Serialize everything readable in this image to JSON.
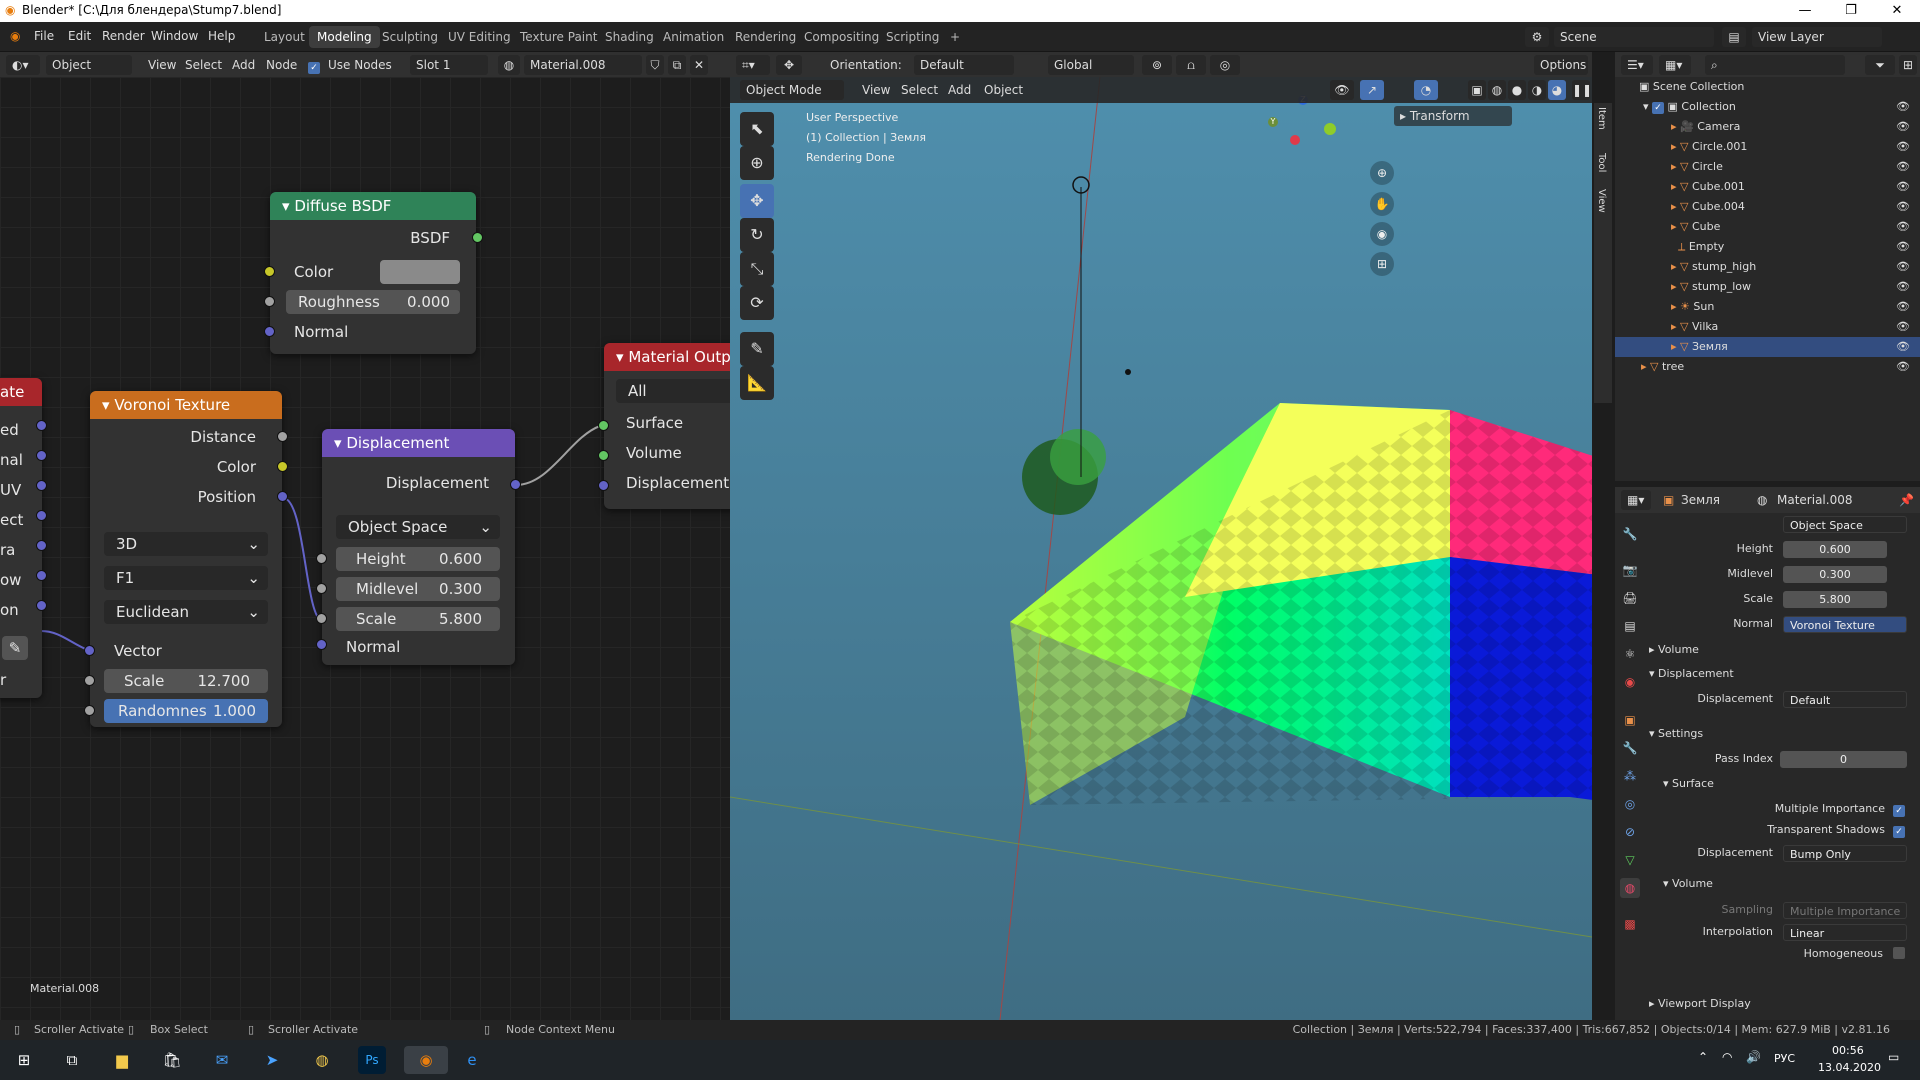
{
  "window": {
    "title": "Blender* [C:\\Для блендера\\Stump7.blend]",
    "minimize": "—",
    "maximize": "❐",
    "close": "✕"
  },
  "menu": {
    "items": [
      "File",
      "Edit",
      "Render",
      "Window",
      "Help"
    ]
  },
  "workspaces": [
    "Layout",
    "Modeling",
    "Sculpting",
    "UV Editing",
    "Texture Paint",
    "Shading",
    "Animation",
    "Rendering",
    "Compositing",
    "Scripting"
  ],
  "workspace_add": "+",
  "scene": {
    "label": "Scene",
    "view_layer": "View Layer"
  },
  "node_header": {
    "mode": "Object",
    "view": "View",
    "select": "Select",
    "add": "Add",
    "node": "Node",
    "use_nodes": "Use Nodes",
    "slot": "Slot 1",
    "material": "Material.008"
  },
  "vp_header": {
    "orientation_label": "Orientation:",
    "orientation": "Default",
    "transform": "Global",
    "options": "Options",
    "mode": "Object Mode",
    "view": "View",
    "select": "Select",
    "add": "Add",
    "object": "Object"
  },
  "nodes": {
    "diffuse": {
      "title": "Diffuse BSDF",
      "out": "BSDF",
      "color": "Color",
      "roughness_label": "Roughness",
      "roughness": "0.000",
      "normal": "Normal",
      "header_color": "#2f8358"
    },
    "voronoi": {
      "title": "Voronoi Texture",
      "distance": "Distance",
      "color": "Color",
      "position": "Position",
      "dim": "3D",
      "feature": "F1",
      "metric": "Euclidean",
      "vector": "Vector",
      "scale_label": "Scale",
      "scale": "12.700",
      "random_label": "Randomnes",
      "random": "1.000",
      "header_color": "#c96d1e"
    },
    "displacement": {
      "title": "Displacement",
      "out": "Displacement",
      "space": "Object Space",
      "height_label": "Height",
      "height": "0.600",
      "midlevel_label": "Midlevel",
      "midlevel": "0.300",
      "scale_label": "Scale",
      "scale": "5.800",
      "normal": "Normal",
      "header_color": "#6b4fb5"
    },
    "output": {
      "title": "Material Outp",
      "target": "All",
      "surface": "Surface",
      "volume": "Volume",
      "displacement": "Displacement",
      "header_color": "#a8262b"
    },
    "partial": {
      "title": "ate",
      "rows": [
        "ed",
        "nal",
        "UV",
        "ect",
        "ra",
        "ow",
        "on",
        "r"
      ],
      "header_color": "#a8262b"
    }
  },
  "node_footer": "Material.008",
  "viewport": {
    "perspective": "User Perspective",
    "collection": "(1) Collection | Земля",
    "status": "Rendering Done",
    "transform_panel": "Transform",
    "side_tabs": [
      "Item",
      "Tool",
      "View"
    ]
  },
  "outliner": {
    "root": "Scene Collection",
    "collection": "Collection",
    "items": [
      "Camera",
      "Circle.001",
      "Circle",
      "Cube.001",
      "Cube.004",
      "Cube",
      "Empty",
      "stump_high",
      "stump_low",
      "Sun",
      "Vilka",
      "Земля"
    ],
    "tree": "tree"
  },
  "props": {
    "object": "Земля",
    "material": "Material.008",
    "space": "Object Space",
    "height_label": "Height",
    "height": "0.600",
    "midlevel_label": "Midlevel",
    "midlevel": "0.300",
    "scale_label": "Scale",
    "scale": "5.800",
    "normal_label": "Normal",
    "normal": "Voronoi Texture",
    "volume": "Volume",
    "displacement_panel": "Displacement",
    "displacement_label": "Displacement",
    "displacement": "Default",
    "settings": "Settings",
    "pass_index_label": "Pass Index",
    "pass_index": "0",
    "surface": "Surface",
    "mult_imp": "Multiple Importance",
    "transp_shadows": "Transparent Shadows",
    "disp_method_label": "Displacement",
    "disp_method": "Bump Only",
    "volume_sub": "Volume",
    "sampling_label": "Sampling",
    "sampling": "Multiple Importance",
    "interp_label": "Interpolation",
    "interp": "Linear",
    "homogeneous": "Homogeneous",
    "viewport_display": "Viewport Display"
  },
  "status": {
    "scroller1": "Scroller Activate",
    "box": "Box Select",
    "scroller2": "Scroller Activate",
    "ctx": "Node Context Menu",
    "stats": "Collection | Земля | Verts:522,794 | Faces:337,400 | Tris:667,852 | Objects:0/14 | Mem: 627.9 MiB | v2.81.16"
  },
  "taskbar": {
    "lang": "РУС",
    "time": "00:56",
    "date": "13.04.2020"
  }
}
